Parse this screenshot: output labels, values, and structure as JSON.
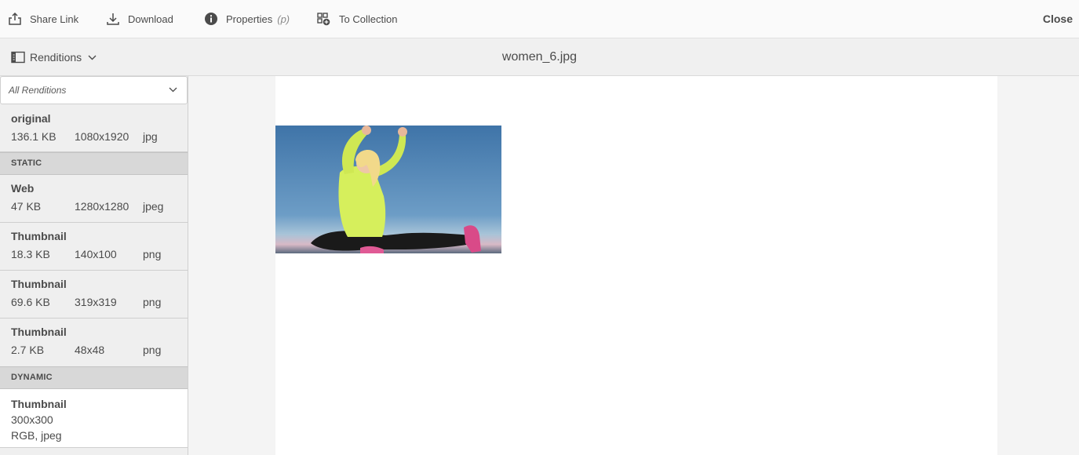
{
  "toolbar": {
    "share_label": "Share Link",
    "download_label": "Download",
    "properties_label": "Properties",
    "properties_shortcut": "(p)",
    "collection_label": "To Collection",
    "close_label": "Close"
  },
  "subbar": {
    "renditions_label": "Renditions",
    "file_name": "women_6.jpg"
  },
  "sidebar": {
    "filter_value": "All Renditions",
    "original": {
      "name": "original",
      "size": "136.1 KB",
      "dims": "1080x1920",
      "format": "jpg"
    },
    "static_header": "STATIC",
    "static_items": [
      {
        "name": "Web",
        "size": "47 KB",
        "dims": "1280x1280",
        "format": "jpeg"
      },
      {
        "name": "Thumbnail",
        "size": "18.3 KB",
        "dims": "140x100",
        "format": "png"
      },
      {
        "name": "Thumbnail",
        "size": "69.6 KB",
        "dims": "319x319",
        "format": "png"
      },
      {
        "name": "Thumbnail",
        "size": "2.7 KB",
        "dims": "48x48",
        "format": "png"
      }
    ],
    "dynamic_header": "DYNAMIC",
    "dynamic_items": [
      {
        "name": "Thumbnail",
        "dims": "300x300",
        "details": "RGB, jpeg"
      }
    ]
  },
  "colors": {
    "sky": "#4f87b8",
    "jacket": "#d8f05a",
    "pants": "#1b1b1b",
    "shoes": "#e24b8a"
  }
}
